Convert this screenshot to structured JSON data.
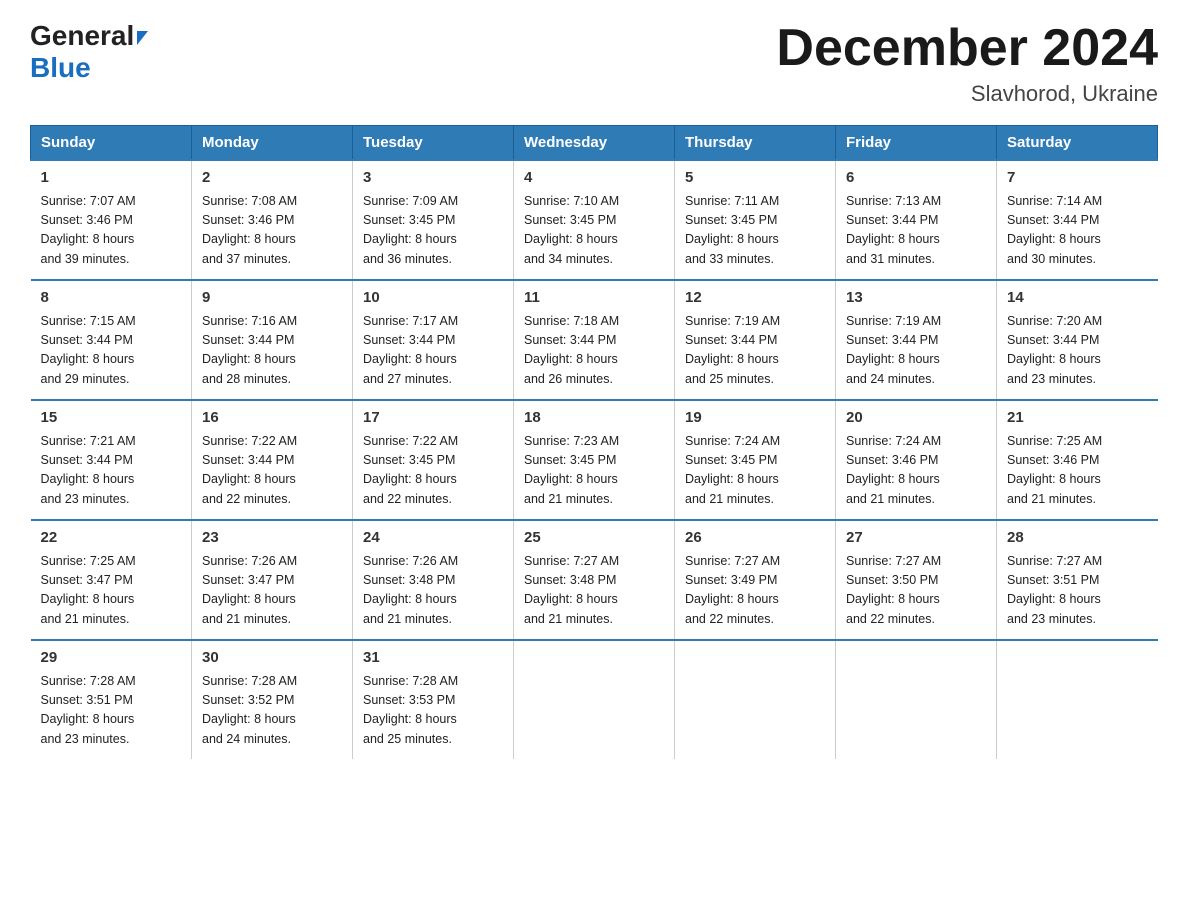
{
  "logo": {
    "general": "General",
    "blue": "Blue"
  },
  "title": {
    "month": "December 2024",
    "location": "Slavhorod, Ukraine"
  },
  "weekdays": [
    "Sunday",
    "Monday",
    "Tuesday",
    "Wednesday",
    "Thursday",
    "Friday",
    "Saturday"
  ],
  "weeks": [
    [
      {
        "day": "1",
        "sunrise": "7:07 AM",
        "sunset": "3:46 PM",
        "daylight": "8 hours and 39 minutes."
      },
      {
        "day": "2",
        "sunrise": "7:08 AM",
        "sunset": "3:46 PM",
        "daylight": "8 hours and 37 minutes."
      },
      {
        "day": "3",
        "sunrise": "7:09 AM",
        "sunset": "3:45 PM",
        "daylight": "8 hours and 36 minutes."
      },
      {
        "day": "4",
        "sunrise": "7:10 AM",
        "sunset": "3:45 PM",
        "daylight": "8 hours and 34 minutes."
      },
      {
        "day": "5",
        "sunrise": "7:11 AM",
        "sunset": "3:45 PM",
        "daylight": "8 hours and 33 minutes."
      },
      {
        "day": "6",
        "sunrise": "7:13 AM",
        "sunset": "3:44 PM",
        "daylight": "8 hours and 31 minutes."
      },
      {
        "day": "7",
        "sunrise": "7:14 AM",
        "sunset": "3:44 PM",
        "daylight": "8 hours and 30 minutes."
      }
    ],
    [
      {
        "day": "8",
        "sunrise": "7:15 AM",
        "sunset": "3:44 PM",
        "daylight": "8 hours and 29 minutes."
      },
      {
        "day": "9",
        "sunrise": "7:16 AM",
        "sunset": "3:44 PM",
        "daylight": "8 hours and 28 minutes."
      },
      {
        "day": "10",
        "sunrise": "7:17 AM",
        "sunset": "3:44 PM",
        "daylight": "8 hours and 27 minutes."
      },
      {
        "day": "11",
        "sunrise": "7:18 AM",
        "sunset": "3:44 PM",
        "daylight": "8 hours and 26 minutes."
      },
      {
        "day": "12",
        "sunrise": "7:19 AM",
        "sunset": "3:44 PM",
        "daylight": "8 hours and 25 minutes."
      },
      {
        "day": "13",
        "sunrise": "7:19 AM",
        "sunset": "3:44 PM",
        "daylight": "8 hours and 24 minutes."
      },
      {
        "day": "14",
        "sunrise": "7:20 AM",
        "sunset": "3:44 PM",
        "daylight": "8 hours and 23 minutes."
      }
    ],
    [
      {
        "day": "15",
        "sunrise": "7:21 AM",
        "sunset": "3:44 PM",
        "daylight": "8 hours and 23 minutes."
      },
      {
        "day": "16",
        "sunrise": "7:22 AM",
        "sunset": "3:44 PM",
        "daylight": "8 hours and 22 minutes."
      },
      {
        "day": "17",
        "sunrise": "7:22 AM",
        "sunset": "3:45 PM",
        "daylight": "8 hours and 22 minutes."
      },
      {
        "day": "18",
        "sunrise": "7:23 AM",
        "sunset": "3:45 PM",
        "daylight": "8 hours and 21 minutes."
      },
      {
        "day": "19",
        "sunrise": "7:24 AM",
        "sunset": "3:45 PM",
        "daylight": "8 hours and 21 minutes."
      },
      {
        "day": "20",
        "sunrise": "7:24 AM",
        "sunset": "3:46 PM",
        "daylight": "8 hours and 21 minutes."
      },
      {
        "day": "21",
        "sunrise": "7:25 AM",
        "sunset": "3:46 PM",
        "daylight": "8 hours and 21 minutes."
      }
    ],
    [
      {
        "day": "22",
        "sunrise": "7:25 AM",
        "sunset": "3:47 PM",
        "daylight": "8 hours and 21 minutes."
      },
      {
        "day": "23",
        "sunrise": "7:26 AM",
        "sunset": "3:47 PM",
        "daylight": "8 hours and 21 minutes."
      },
      {
        "day": "24",
        "sunrise": "7:26 AM",
        "sunset": "3:48 PM",
        "daylight": "8 hours and 21 minutes."
      },
      {
        "day": "25",
        "sunrise": "7:27 AM",
        "sunset": "3:48 PM",
        "daylight": "8 hours and 21 minutes."
      },
      {
        "day": "26",
        "sunrise": "7:27 AM",
        "sunset": "3:49 PM",
        "daylight": "8 hours and 22 minutes."
      },
      {
        "day": "27",
        "sunrise": "7:27 AM",
        "sunset": "3:50 PM",
        "daylight": "8 hours and 22 minutes."
      },
      {
        "day": "28",
        "sunrise": "7:27 AM",
        "sunset": "3:51 PM",
        "daylight": "8 hours and 23 minutes."
      }
    ],
    [
      {
        "day": "29",
        "sunrise": "7:28 AM",
        "sunset": "3:51 PM",
        "daylight": "8 hours and 23 minutes."
      },
      {
        "day": "30",
        "sunrise": "7:28 AM",
        "sunset": "3:52 PM",
        "daylight": "8 hours and 24 minutes."
      },
      {
        "day": "31",
        "sunrise": "7:28 AM",
        "sunset": "3:53 PM",
        "daylight": "8 hours and 25 minutes."
      },
      null,
      null,
      null,
      null
    ]
  ],
  "labels": {
    "sunrise": "Sunrise:",
    "sunset": "Sunset:",
    "daylight": "Daylight:"
  }
}
